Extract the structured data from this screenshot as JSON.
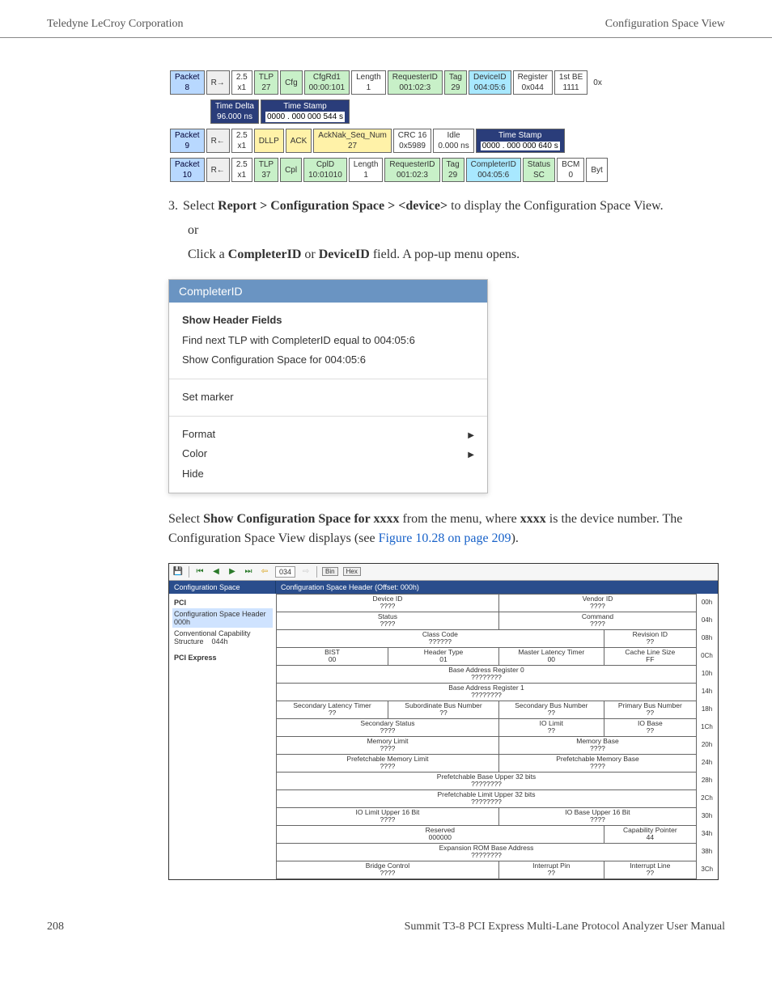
{
  "header": {
    "left": "Teledyne LeCroy Corporation",
    "right": "Configuration Space View"
  },
  "packets": {
    "row1": {
      "packet_label": "Packet",
      "packet_num": "8",
      "dir": "R→",
      "gen": "2.5",
      "gen2": "x1",
      "type": "TLP",
      "type_num": "27",
      "cfg": "Cfg",
      "cfg_rd": "CfgRd1",
      "cfg_val": "00:00:101",
      "length_label": "Length",
      "length_val": "1",
      "req_label": "RequesterID",
      "req_val": "001:02:3",
      "tag_label": "Tag",
      "tag_val": "29",
      "dev_label": "DeviceID",
      "dev_val": "004:05:6",
      "reg_label": "Register",
      "reg_val": "0x044",
      "be_label": "1st BE",
      "be_val": "1111",
      "ox": "0x"
    },
    "row1b": {
      "td_label": "Time Delta",
      "td_val": "96.000 ns",
      "ts_label": "Time Stamp",
      "ts_val": "0000 . 000 000 544 s"
    },
    "row2": {
      "packet_label": "Packet",
      "packet_num": "9",
      "dir": "R←",
      "gen": "2.5",
      "gen2": "x1",
      "type": "DLLP",
      "ack": "ACK",
      "ack_seq_label": "AckNak_Seq_Num",
      "ack_seq_val": "27",
      "crc_label": "CRC 16",
      "crc_val": "0x5989",
      "idle_label": "Idle",
      "idle_val": "0.000 ns",
      "ts_label": "Time Stamp",
      "ts_val": "0000 . 000 000 640 s"
    },
    "row3": {
      "packet_label": "Packet",
      "packet_num": "10",
      "dir": "R←",
      "gen": "2.5",
      "gen2": "x1",
      "type": "TLP",
      "type_num": "37",
      "cpl": "Cpl",
      "cpld_label": "CplD",
      "cpld_val": "10:01010",
      "length_label": "Length",
      "length_val": "1",
      "req_label": "RequesterID",
      "req_val": "001:02:3",
      "tag_label": "Tag",
      "tag_val": "29",
      "comp_label": "CompleterID",
      "comp_val": "004:05:6",
      "status_label": "Status",
      "status_val": "SC",
      "bcm": "BCM",
      "bcm_val": "0",
      "byt": "Byt"
    }
  },
  "instruction": {
    "num": "3.",
    "text1a": "Select ",
    "bold1": "Report > Configuration Space > <device>",
    "text1b": " to display the Configuration Space View.",
    "or": "or",
    "text2a": "Click a ",
    "bold2a": "CompleterID",
    "text2b": " or ",
    "bold2b": "DeviceID",
    "text2c": " field. A pop-up menu opens."
  },
  "popup": {
    "title": "CompleterID",
    "show_header": "Show Header Fields",
    "find_next": "Find next TLP with CompleterID equal to 004:05:6",
    "show_cfg": "Show Configuration Space for 004:05:6",
    "set_marker": "Set marker",
    "format": "Format",
    "color": "Color",
    "hide": "Hide"
  },
  "para": {
    "t1": "Select ",
    "b1": "Show Configuration Space for xxxx",
    "t2": " from the menu, where ",
    "b2": "xxxx",
    "t3": " is the device number. The Configuration Space View displays (see ",
    "link": "Figure 10.28 on page 209",
    "t4": ")."
  },
  "cfg_view": {
    "toolbar": {
      "addr": "034",
      "bin": "Bin",
      "hex": "Hex"
    },
    "left_hdr": "Configuration Space",
    "right_hdr": "Configuration Space Header (Offset: 000h)",
    "sidebar": {
      "pci": "PCI",
      "item1": "Configuration Space Header  000h",
      "item2": "Conventional Capability Structure",
      "item2b": "044h",
      "pcie": "PCI Express"
    },
    "rows": [
      {
        "off": "00h",
        "cells": [
          {
            "l": "Device ID",
            "v": "????",
            "w": 2
          },
          {
            "l": "Vendor ID",
            "v": "????",
            "w": 2
          }
        ]
      },
      {
        "off": "04h",
        "cells": [
          {
            "l": "Status",
            "v": "????",
            "w": 2
          },
          {
            "l": "Command",
            "v": "????",
            "w": 2
          }
        ]
      },
      {
        "off": "08h",
        "cells": [
          {
            "l": "Class Code",
            "v": "??????",
            "w": 3
          },
          {
            "l": "Revision ID",
            "v": "??",
            "w": 1
          }
        ]
      },
      {
        "off": "0Ch",
        "cells": [
          {
            "l": "BIST",
            "v": "00",
            "w": 1
          },
          {
            "l": "Header Type",
            "v": "01",
            "w": 1
          },
          {
            "l": "Master Latency Timer",
            "v": "00",
            "w": 1
          },
          {
            "l": "Cache Line Size",
            "v": "FF",
            "w": 1
          }
        ]
      },
      {
        "off": "10h",
        "cells": [
          {
            "l": "Base Address Register 0",
            "v": "????????",
            "w": 4
          }
        ]
      },
      {
        "off": "14h",
        "cells": [
          {
            "l": "Base Address Register 1",
            "v": "????????",
            "w": 4
          }
        ]
      },
      {
        "off": "18h",
        "cells": [
          {
            "l": "Secondary Latency Timer",
            "v": "??",
            "w": 1
          },
          {
            "l": "Subordinate Bus Number",
            "v": "??",
            "w": 1
          },
          {
            "l": "Secondary Bus Number",
            "v": "??",
            "w": 1
          },
          {
            "l": "Primary Bus Number",
            "v": "??",
            "w": 1
          }
        ]
      },
      {
        "off": "1Ch",
        "cells": [
          {
            "l": "Secondary Status",
            "v": "????",
            "w": 2
          },
          {
            "l": "IO Limit",
            "v": "??",
            "w": 1
          },
          {
            "l": "IO Base",
            "v": "??",
            "w": 1
          }
        ]
      },
      {
        "off": "20h",
        "cells": [
          {
            "l": "Memory Limit",
            "v": "????",
            "w": 2
          },
          {
            "l": "Memory Base",
            "v": "????",
            "w": 2
          }
        ]
      },
      {
        "off": "24h",
        "cells": [
          {
            "l": "Prefetchable Memory Limit",
            "v": "????",
            "w": 2
          },
          {
            "l": "Prefetchable Memory Base",
            "v": "????",
            "w": 2
          }
        ]
      },
      {
        "off": "28h",
        "cells": [
          {
            "l": "Prefetchable Base Upper 32 bits",
            "v": "????????",
            "w": 4
          }
        ]
      },
      {
        "off": "2Ch",
        "cells": [
          {
            "l": "Prefetchable Limit Upper 32 bits",
            "v": "????????",
            "w": 4
          }
        ]
      },
      {
        "off": "30h",
        "cells": [
          {
            "l": "IO Limit Upper 16 Bit",
            "v": "????",
            "w": 2
          },
          {
            "l": "IO Base Upper 16 Bit",
            "v": "????",
            "w": 2
          }
        ]
      },
      {
        "off": "34h",
        "cells": [
          {
            "l": "Reserved",
            "v": "000000",
            "w": 3
          },
          {
            "l": "Capability Pointer",
            "v": "44",
            "w": 1
          }
        ]
      },
      {
        "off": "38h",
        "cells": [
          {
            "l": "Expansion ROM Base Address",
            "v": "????????",
            "w": 4
          }
        ]
      },
      {
        "off": "3Ch",
        "cells": [
          {
            "l": "Bridge Control",
            "v": "????",
            "w": 2
          },
          {
            "l": "Interrupt Pin",
            "v": "??",
            "w": 1
          },
          {
            "l": "Interrupt Line",
            "v": "??",
            "w": 1
          }
        ]
      }
    ]
  },
  "footer": {
    "page": "208",
    "title": "Summit T3-8 PCI Express Multi-Lane Protocol Analyzer User Manual"
  }
}
